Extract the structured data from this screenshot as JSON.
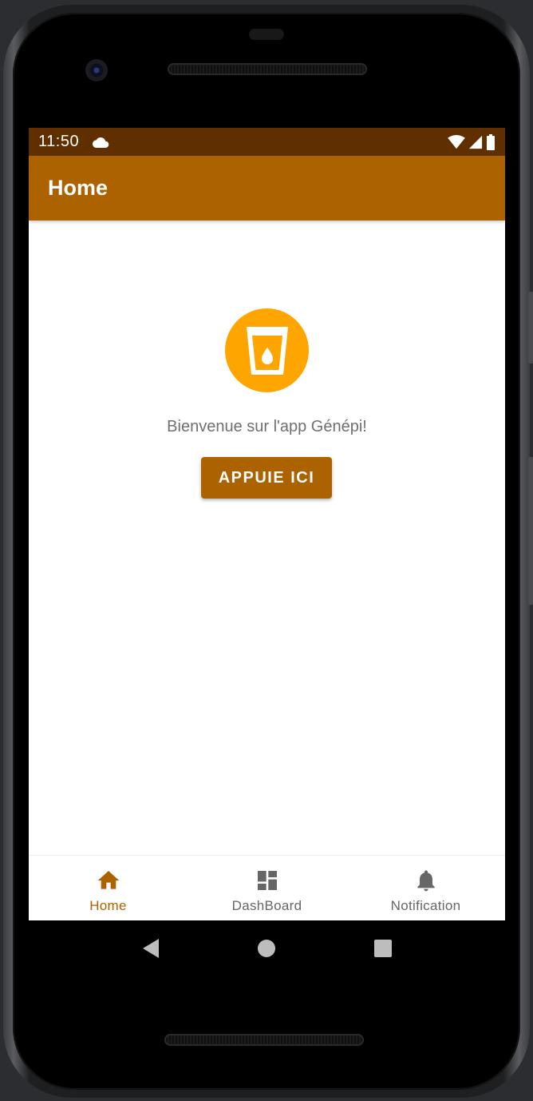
{
  "status_bar": {
    "time": "11:50",
    "icons": [
      "cloud-icon",
      "wifi-icon",
      "signal-icon",
      "battery-icon"
    ]
  },
  "app_bar": {
    "title": "Home"
  },
  "main": {
    "hero_icon": "water-cup-icon",
    "welcome_text": "Bienvenue sur l'app Génépi!",
    "button_label": "APPUIE ICI"
  },
  "bottom_nav": {
    "items": [
      {
        "label": "Home",
        "icon": "home-icon",
        "active": true
      },
      {
        "label": "DashBoard",
        "icon": "dashboard-icon",
        "active": false
      },
      {
        "label": "Notification",
        "icon": "bell-icon",
        "active": false
      }
    ]
  },
  "system_nav": [
    "back-icon",
    "home-circle-icon",
    "recents-icon"
  ],
  "colors": {
    "status_bar": "#602f00",
    "primary": "#ad6200",
    "accent": "#ffa500",
    "text_secondary": "#6f6f6f"
  }
}
